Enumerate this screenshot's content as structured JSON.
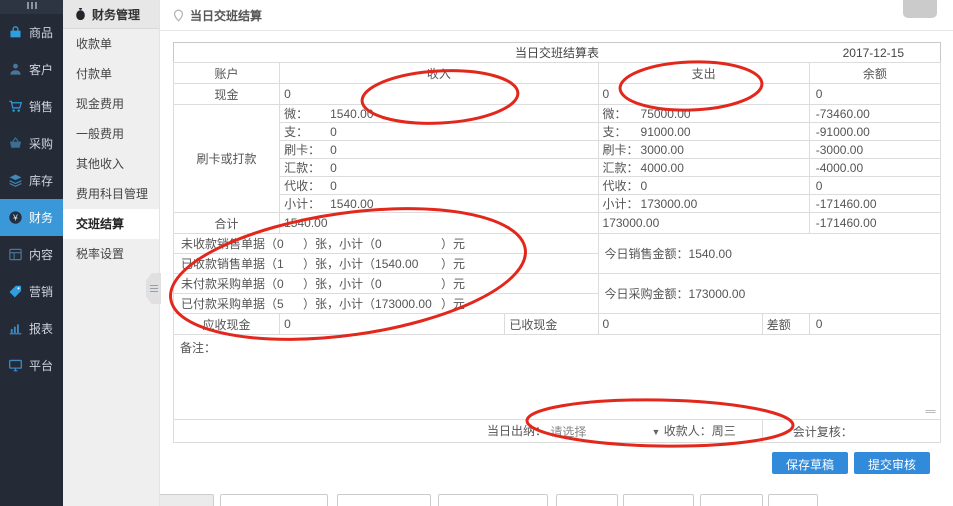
{
  "colors": {
    "accent_blue": "#3a97d8",
    "button_blue": "#318ada",
    "annotation_red": "#e2271c",
    "sidebar_bg": "#242a36",
    "submenu_bg": "#efefef"
  },
  "icons": {
    "dropdown_arrow": "▼"
  },
  "sidebar": {
    "collapse_icon": "menu-bars",
    "items": [
      {
        "label": "商品",
        "icon": "bag-icon"
      },
      {
        "label": "客户",
        "icon": "person-icon"
      },
      {
        "label": "销售",
        "icon": "cart-icon"
      },
      {
        "label": "采购",
        "icon": "basket-icon"
      },
      {
        "label": "库存",
        "icon": "layers-icon"
      },
      {
        "label": "财务",
        "icon": "yen-circle-icon",
        "active": true
      },
      {
        "label": "内容",
        "icon": "grid-icon"
      },
      {
        "label": "营销",
        "icon": "tag-icon"
      },
      {
        "label": "报表",
        "icon": "bar-chart-icon"
      },
      {
        "label": "平台",
        "icon": "monitor-icon"
      }
    ]
  },
  "submenu": {
    "header": "财务管理",
    "header_icon": "money-bag-icon",
    "items": [
      "收款单",
      "付款单",
      "现金费用",
      "一般费用",
      "其他收入",
      "费用科目管理",
      "交班结算",
      "税率设置"
    ],
    "selected": "交班结算"
  },
  "breadcrumb": "当日交班结算",
  "sheet": {
    "title": "当日交班结算表",
    "date": "2017-12-15",
    "columns": {
      "account": "账户",
      "income": "收入",
      "expense": "支出",
      "balance": "余额"
    },
    "cash_row": {
      "label": "现金",
      "income": "0",
      "expense": "0",
      "balance": "0"
    },
    "group_label": "刷卡或打款",
    "group_rows": [
      {
        "label": "微：",
        "income": "1540.00",
        "expense_label": "微：",
        "expense": "75000.00",
        "balance": "-73460.00"
      },
      {
        "label": "支：",
        "income": "0",
        "expense_label": "支：",
        "expense": "91000.00",
        "balance": "-91000.00"
      },
      {
        "label": "刷卡：",
        "income": "0",
        "expense_label": "刷卡：",
        "expense": "3000.00",
        "balance": "-3000.00"
      },
      {
        "label": "汇款：",
        "income": "0",
        "expense_label": "汇款：",
        "expense": "4000.00",
        "balance": "-4000.00"
      },
      {
        "label": "代收：",
        "income": "0",
        "expense_label": "代收：",
        "expense": "0",
        "balance": "0"
      },
      {
        "label": "小计：",
        "income": "1540.00",
        "expense_label": "小计：",
        "expense": "173000.00",
        "balance": "-171460.00"
      }
    ],
    "total_row": {
      "label": "合计",
      "income": "1540.00",
      "expense": "173000.00",
      "balance": "-171460.00"
    },
    "doc_rows": [
      {
        "prefix": "未收款销售单据（",
        "count": "0",
        "mid": "）张，小计（",
        "subtotal": "0",
        "suffix": "）元"
      },
      {
        "prefix": "已收款销售单据（",
        "count": "1",
        "mid": "）张，小计（",
        "subtotal": "1540.00",
        "suffix": "）元"
      },
      {
        "prefix": "未付款采购单据（",
        "count": "0",
        "mid": "）张，小计（",
        "subtotal": "0",
        "suffix": "）元"
      },
      {
        "prefix": "已付款采购单据（",
        "count": "5",
        "mid": "）张，小计（",
        "subtotal": "173000.00",
        "suffix": "）元"
      }
    ],
    "summary": {
      "sales": "今日销售金额：1540.00",
      "purchase": "今日采购金额：173000.00"
    },
    "recv_row": {
      "label": "应收现金",
      "value": "0",
      "label2": "已收现金",
      "value2": "0",
      "label3": "差额",
      "value3": "0"
    },
    "note_label": "备注：",
    "cashier_row": {
      "cashier_label": "当日出纳：",
      "select_value": "请选择",
      "payee": "收款人：周三",
      "review": "会计复核："
    }
  },
  "buttons": {
    "save": "保存草稿",
    "submit": "提交审核"
  }
}
